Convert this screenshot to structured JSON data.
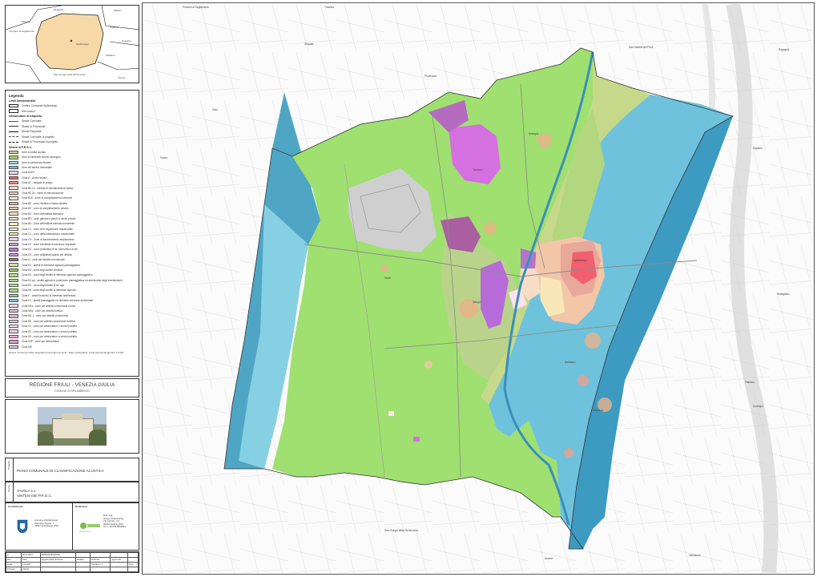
{
  "inset_map": {
    "labels": [
      "Ragogna",
      "Majano",
      "Dignano",
      "Coseano",
      "Flaibano",
      "San Daniele del Friuli",
      "Spilimbergo",
      "Pinzano al Tagliamento",
      "Sequals",
      "San Giorgio della Richinvelda",
      "Arzene"
    ]
  },
  "legend": {
    "title": "Legenda",
    "sections": [
      {
        "heading": "Limiti Amministrativi",
        "items": [
          {
            "label": "Confine Comunale Spilimbergo",
            "kind": "box",
            "color": "#ffffff"
          },
          {
            "label": "Altri comuni",
            "kind": "box",
            "color": "#ffffff"
          }
        ]
      },
      {
        "heading": "Infrastrutture di trasporto",
        "items": [
          {
            "label": "Strade Comunale",
            "kind": "line",
            "color": "#555555",
            "dash": "solid"
          },
          {
            "label": "Strade di Provinciale",
            "kind": "line",
            "color": "#333333",
            "dash": "solid"
          },
          {
            "label": "Strade Regionale",
            "kind": "line",
            "color": "#111111",
            "dash": "solid"
          },
          {
            "label": "Strade Comunale di progetto",
            "kind": "line",
            "color": "#555555",
            "dash": "dashed"
          },
          {
            "label": "Strade di Provinciale di progetto",
            "kind": "line",
            "color": "#111111",
            "dash": "dashed"
          }
        ]
      },
      {
        "heading": "Sintesi di P.R.G.C.",
        "items": [
          {
            "label": "Aree a ridotta acciaio",
            "kind": "swatch",
            "color": "#c7cf8a"
          },
          {
            "label": "Aree di interesse storico-tipologico",
            "kind": "swatch",
            "color": "#a9c96b"
          },
          {
            "label": "Aree di pertinenza fluviale",
            "kind": "swatch",
            "color": "#9bd8e0"
          },
          {
            "label": "Aree del bacino demaniale",
            "kind": "swatch",
            "color": "#6fb7d9"
          },
          {
            "label": "Zona A0CH",
            "kind": "swatch",
            "color": "#f0d7e4"
          },
          {
            "label": "Zona A - centro storico",
            "kind": "swatch",
            "color": "#f06070"
          },
          {
            "label": "Zona A7 - borgate di pregio",
            "kind": "swatch",
            "color": "#e98a7a"
          },
          {
            "label": "Zona B0.1s - centrali di ristrutturazione bassa",
            "kind": "swatch",
            "color": "#f6e0c4"
          },
          {
            "label": "Zona B0.2s - centri di ristrutturazione",
            "kind": "swatch",
            "color": "#f2cfa5"
          },
          {
            "label": "Zona B1b - zone di completamento intensive",
            "kind": "swatch",
            "color": "#f8e8b8"
          },
          {
            "label": "Zona B0 - zone ricettive a bassa densità",
            "kind": "swatch",
            "color": "#e8b38a"
          },
          {
            "label": "Zona B2 - zone di completamento urbano",
            "kind": "swatch",
            "color": "#f3c6a8"
          },
          {
            "label": "Zona B3 - zone dell'edilizia estensiva",
            "kind": "swatch",
            "color": "#f7dcc6"
          },
          {
            "label": "Zona BD - sedi, giardini e parchi a verde privato",
            "kind": "swatch",
            "color": "#fbeacb"
          },
          {
            "label": "Zona Ab - Zona dell'edilizia estensiva esistente",
            "kind": "swatch",
            "color": "#f9f2b9"
          },
          {
            "label": "Zona C1 - zone di fri espansione residenziale",
            "kind": "swatch",
            "color": "#fdf6c4"
          },
          {
            "label": "Zona C2 - zone della lottizzazione residenziale",
            "kind": "swatch",
            "color": "#f7ef9d"
          },
          {
            "label": "Zona C5 - Zone di frazionamento ampliamento",
            "kind": "swatch",
            "color": "#ecd6f1"
          },
          {
            "label": "Zona D1 - zone industriali di interesse regionale",
            "kind": "swatch",
            "color": "#c89fd8"
          },
          {
            "label": "Zona D2 - zona produttiva di ist. economico di ieri",
            "kind": "swatch",
            "color": "#b479cf"
          },
          {
            "label": "Zona D3 - zone artigianali sparse per attività",
            "kind": "swatch",
            "color": "#d48dde"
          },
          {
            "label": "Zona H - zone per attività commerciali",
            "kind": "swatch",
            "color": "#a95f9a"
          },
          {
            "label": "Zona E4 - ambiti di interesse agricolo-paesaggistico",
            "kind": "swatch",
            "color": "#cde59a"
          },
          {
            "label": "Zona E5 - zona degli ambiti boschivi",
            "kind": "swatch",
            "color": "#96c96a"
          },
          {
            "label": "Zona E4 - zona degli ambiti di interesse agricolo-paesaggistico",
            "kind": "swatch",
            "color": "#b7d97f"
          },
          {
            "label": "Zona E4 ap - ambiti agricoli di protezione paesaggistica ed ambientale degli insediamenti",
            "kind": "swatch",
            "color": "#a8d38a"
          },
          {
            "label": "Zona E5 - zona degli ambiti di int. agr.",
            "kind": "swatch",
            "color": "#b6e67d"
          },
          {
            "label": "Zona E6 - zona degli ambiti di interesse agricolo",
            "kind": "swatch",
            "color": "#9edc6a"
          },
          {
            "label": "Zona F - ambiti boschivi di interesse ambientale",
            "kind": "swatch",
            "color": "#8fc7b8"
          },
          {
            "label": "Zona F4 - ambiti paesaggistici di rilevante interesse ambientale",
            "kind": "swatch",
            "color": "#7bc3d0"
          },
          {
            "label": "Zona M1s - zone per attività commerciali nuove",
            "kind": "swatch",
            "color": "#f3d3e9"
          },
          {
            "label": "Zona M2s - zone per attività ricettive",
            "kind": "swatch",
            "color": "#eac0db"
          },
          {
            "label": "Zona M1.1 - zone per attività commerciali",
            "kind": "swatch",
            "color": "#e3b6d2"
          },
          {
            "label": "Zona B3 - zone per attività commerciali ricettive",
            "kind": "swatch",
            "color": "#d8c6e6"
          },
          {
            "label": "Zona S1 - zone per attrezzature e servizi pubblici",
            "kind": "swatch",
            "color": "#fde1f0"
          },
          {
            "label": "Zona S2 - zone per attrezzature e servizi pubblici",
            "kind": "swatch",
            "color": "#f7c9e4"
          },
          {
            "label": "Zona S3 - zone per attrezzature e servizi pubblici",
            "kind": "swatch",
            "color": "#efb0d7"
          },
          {
            "label": "Zona S3P - zone per attrezzature",
            "kind": "swatch",
            "color": "#e88fc5"
          },
          {
            "label": "Zona MS",
            "kind": "swatch",
            "color": "#d6d6d6"
          }
        ]
      }
    ],
    "note": "Sintesi: Sintesi dei Piani Regolatori Generali Comunali - Base cartografica: Carta Tecnica Regionale 1:5.000"
  },
  "title_block": {
    "region": "REGIONE FRIULI - VENEZIA GIULIA",
    "municipality": "COMUNE DI SPILIMBERGO"
  },
  "project_box": {
    "side_label": "Progetto",
    "text": "PIANO COMUNALE DI CLASSIFICAZIONE ACUSTICA"
  },
  "sheet_box": {
    "side_label": "Tavola",
    "line1": "TAVOLA 1.1",
    "line2": "SINTESI DEI P.R.G.C."
  },
  "client_box": {
    "caption": "Committente",
    "lines": [
      "Comune di Spilimbergo",
      "Piazzetta Tiepolo, 1",
      "33097 Spilimbergo (PN)"
    ]
  },
  "designer_box": {
    "caption": "Redazione",
    "brand": "ENVIROTECH",
    "lines": [
      "Dott. Ingr.",
      "Gruppo Engineering",
      "Via Lazzaro, 1/c",
      "35010 Padova (PD)",
      "Tel. + 39 049 8802653"
    ]
  },
  "revision_table": {
    "rows": [
      [
        "A",
        "28.04.2021",
        "PRIMA EMISSIONE",
        "",
        "",
        "",
        ""
      ],
      [
        "Rev.",
        "Data",
        "Oggetto della revisione",
        "Redatto",
        "Verificato",
        "Approvato",
        ""
      ],
      [
        "Scala",
        "1:10.000",
        "",
        "",
        "TAVOLA 1.1",
        "",
        "Prot."
      ],
      [
        "Formato",
        "UNI A0",
        "",
        "",
        "",
        "",
        ""
      ]
    ]
  },
  "map_labels": [
    "Pinzano al Tagliamento",
    "Travesio",
    "Sequals",
    "Ragogna",
    "Dignano",
    "San Daniele del Friuli",
    "Flaibano",
    "Vivaro",
    "San Giorgio della Richinvelda",
    "Arzene",
    "Valvasone",
    "Codroipo",
    "Sedegliano",
    "Provesano",
    "Barbeano",
    "Tauriano",
    "Gaio",
    "Baseglia",
    "Istrago",
    "Vacile",
    "Gradisca",
    "Spilimbergo"
  ]
}
